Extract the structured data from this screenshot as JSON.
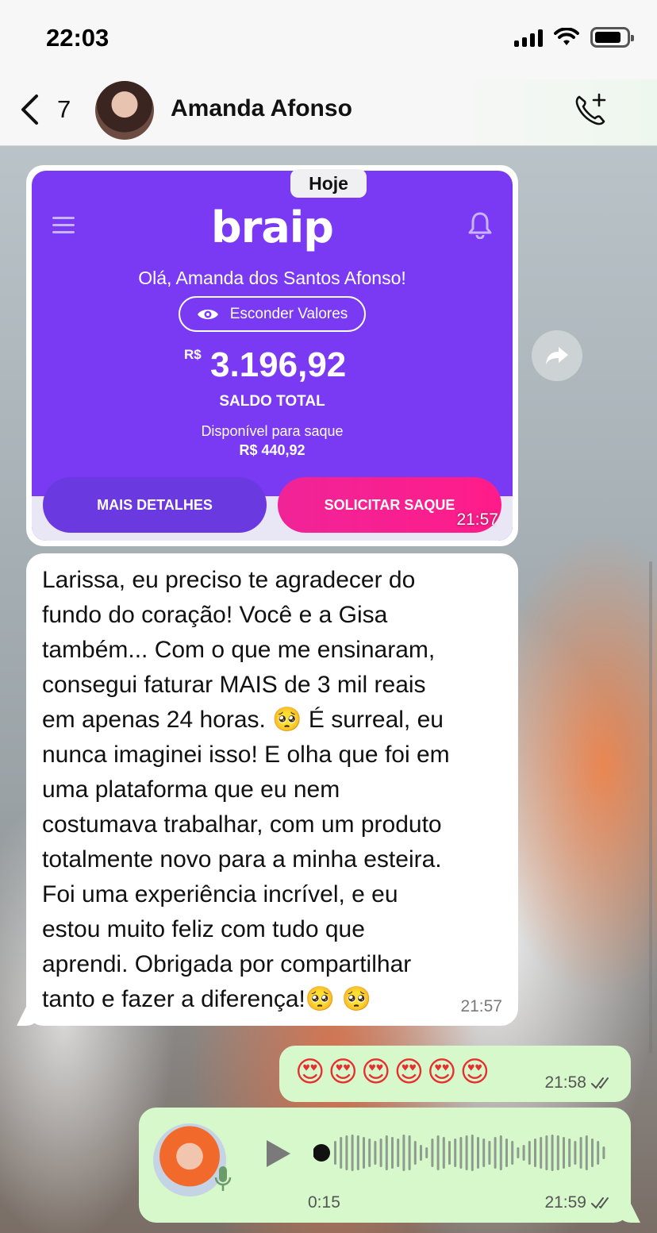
{
  "status_bar": {
    "time": "22:03"
  },
  "header": {
    "back_count": "7",
    "contact_name": "Amanda Afonso"
  },
  "date_chip": "Hoje",
  "image_message": {
    "card": {
      "logo": "braip",
      "greeting": "Olá, Amanda dos Santos Afonso!",
      "hide_values": "Esconder Valores",
      "currency": "R$",
      "balance": "3.196,92",
      "balance_label": "SALDO TOTAL",
      "available_label": "Disponível para saque",
      "available_value": "R$ 440,92",
      "details_button": "MAIS DETALHES",
      "withdraw_button": "SOLICITAR SAQUE"
    },
    "time": "21:57"
  },
  "text_message": {
    "text": "Larissa, eu preciso te agradecer do\nfundo do coração! Você e a Gisa\ntambém... Com o que me ensinaram,\nconsegui faturar MAIS de 3 mil reais\nem apenas 24 horas. 🥺 É surreal, eu\nnunca imaginei isso! E olha que foi em\numa plataforma que eu nem\ncostumava trabalhar, com um produto\ntotalmente novo para a minha esteira.\nFoi uma experiência incrível, e eu\nestou muito feliz com tudo que\naprendi. Obrigada por compartilhar\ntanto e fazer a diferença!🥺 🥺",
    "time": "21:57"
  },
  "outgoing_emoji": {
    "emojis": "😍😍😍😍😍😍",
    "time": "21:58"
  },
  "voice_message": {
    "duration": "0:15",
    "time": "21:59"
  },
  "colors": {
    "card_purple": "#7a3af3",
    "withdraw_pink": "#f02497",
    "outgoing_bubble": "#d6f8cb",
    "read_check": "#555555"
  }
}
